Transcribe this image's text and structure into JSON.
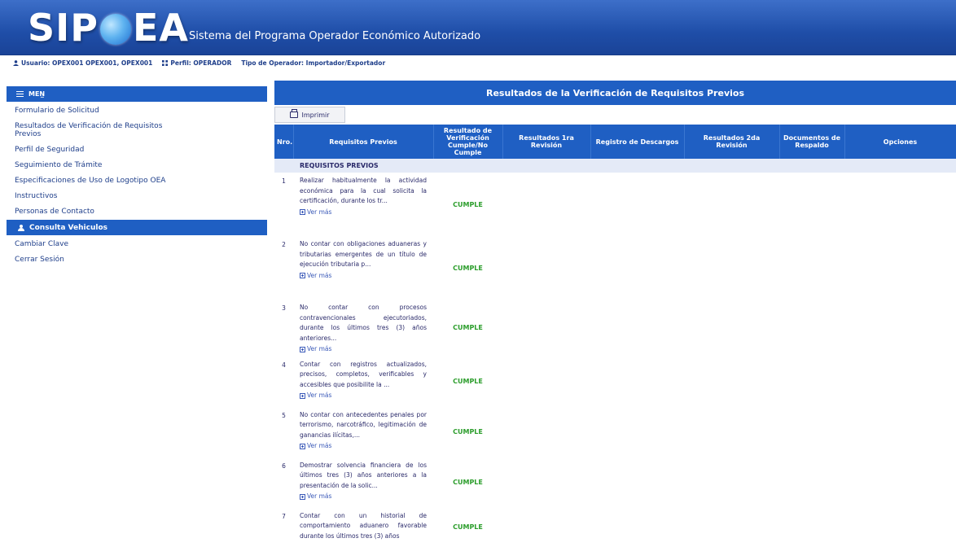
{
  "header": {
    "logo_left": "SIP",
    "logo_right": "EA",
    "subtitle": "Sistema del Programa Operador Económico Autorizado"
  },
  "userbar": {
    "usuario": "Usuario: OPEX001 OPEX001, OPEX001",
    "perfil": "Perfil: OPERADOR",
    "tipo": "Tipo de Operador: Importador/Exportador"
  },
  "sidebar": {
    "menu_label": "MEN̲",
    "items": [
      {
        "label": "Formulario de Solicitud"
      },
      {
        "label": "Resultados de Verificación de Requisitos Previos"
      },
      {
        "label": "Perfil de Seguridad"
      },
      {
        "label": "Seguimiento de Trámite"
      },
      {
        "label": "Especificaciones de Uso de Logotipo OEA"
      },
      {
        "label": "Instructivos"
      },
      {
        "label": "Personas de Contacto"
      },
      {
        "label": "Consulta Vehiculos"
      },
      {
        "label": "Cambiar Clave"
      },
      {
        "label": "Cerrar Sesión"
      }
    ]
  },
  "main": {
    "title": "Resultados de la Verificación de Requisitos Previos",
    "print_label": "Imprimir",
    "columns": [
      "Nro.",
      "Requisitos Previos",
      "Resultado de Verificación Cumple/No Cumple",
      "Resultados 1ra Revisión",
      "Registro de Descargos",
      "Resultados 2da Revisión",
      "Documentos de Respaldo",
      "Opciones"
    ],
    "section_label": "REQUISITOS PREVIOS",
    "ver_mas": "Ver más",
    "rows": [
      {
        "nro": "1",
        "text": "Realizar habitualmente la actividad económica para la cual solicita la certificación, durante los tr...",
        "result": "CUMPLE"
      },
      {
        "nro": "2",
        "text": "No contar con obligaciones aduaneras y tributarias emergentes de un título de ejecución tributaria p...",
        "result": "CUMPLE"
      },
      {
        "nro": "3",
        "text": "No contar con procesos contravencionales ejecutoriados, durante los últimos tres (3) años anteriores...",
        "result": "CUMPLE"
      },
      {
        "nro": "4",
        "text": "Contar con registros actualizados, precisos, completos, verificables y accesibles que posibilite la ...",
        "result": "CUMPLE"
      },
      {
        "nro": "5",
        "text": "No contar con antecedentes penales por terrorismo, narcotráfico, legitimación de ganancias ilícitas,...",
        "result": "CUMPLE"
      },
      {
        "nro": "6",
        "text": "Demostrar solvencia financiera de los últimos tres (3) años anteriores a la presentación de la solic...",
        "result": "CUMPLE"
      },
      {
        "nro": "7",
        "text": "Contar con un historial de comportamiento aduanero favorable durante los últimos tres (3) años",
        "result": "CUMPLE"
      }
    ]
  },
  "colors": {
    "header_blue": "#1f4ea8",
    "accent_blue": "#1f5fc3",
    "cumple_green": "#2b9d2b"
  }
}
